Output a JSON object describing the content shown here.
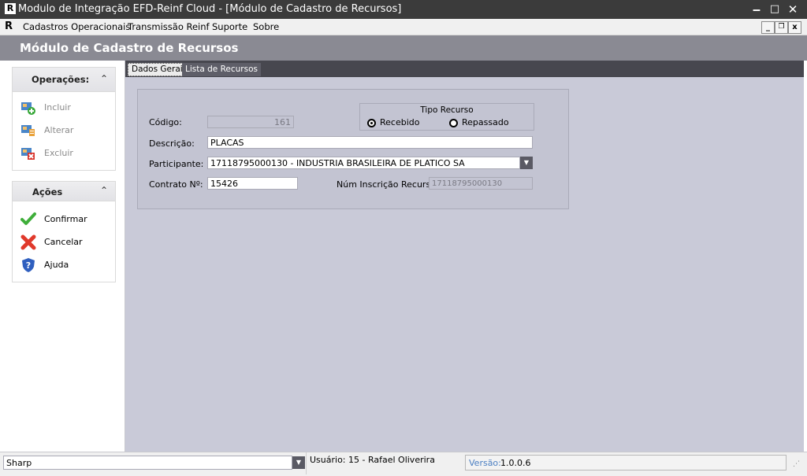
{
  "window": {
    "title": "Modulo de Integração EFD-Reinf Cloud - [Módulo de Cadastro de Recursos]",
    "logo": "R",
    "controls": {
      "minimize": "▁",
      "maximize": "□",
      "close": "✕"
    }
  },
  "menu": {
    "logo": "R",
    "items": [
      "Cadastros Operacionais",
      "Transmissão Reinf",
      "Suporte",
      "Sobre"
    ],
    "mdi": {
      "minimize": "_",
      "restore": "🗗",
      "close": "x"
    }
  },
  "header": {
    "title": "Módulo de Cadastro de Recursos"
  },
  "sidebar": {
    "operacoes": {
      "title": "Operações:",
      "items": [
        {
          "label": "Incluir",
          "icon": "add-record-icon"
        },
        {
          "label": "Alterar",
          "icon": "edit-record-icon"
        },
        {
          "label": "Excluir",
          "icon": "delete-record-icon"
        }
      ]
    },
    "acoes": {
      "title": "Ações",
      "items": [
        {
          "label": "Confirmar",
          "icon": "checkmark-icon"
        },
        {
          "label": "Cancelar",
          "icon": "cross-icon"
        },
        {
          "label": "Ajuda",
          "icon": "help-shield-icon"
        }
      ]
    },
    "chevron": "⌃"
  },
  "tabs": [
    "Dados Gerais",
    "Lista de Recursos"
  ],
  "form": {
    "codigo": {
      "label": "Código:",
      "value": "161"
    },
    "tipo_recurso": {
      "title": "Tipo Recurso",
      "options": [
        "Recebido",
        "Repassado"
      ],
      "selected": "Recebido"
    },
    "descricao": {
      "label": "Descrição:",
      "value": "PLACAS"
    },
    "participante": {
      "label": "Participante:",
      "value": "17118795000130 - INDUSTRIA BRASILEIRA DE PLATICO SA"
    },
    "contrato": {
      "label": "Contrato Nº:",
      "value": "15426"
    },
    "inscricao": {
      "label": "Núm Inscrição Recurso:",
      "value": "17118795000130"
    }
  },
  "statusbar": {
    "theme": "Sharp",
    "user": "Usuário: 15 - Rafael Oliverira",
    "version_label": "Versão:",
    "version_value": "1.0.0.6"
  },
  "colors": {
    "titlebar": "#3b3b3b",
    "header": "#8a8a93",
    "content": "#c9cad8",
    "tabstrip": "#47474f",
    "version_label": "#4a7ec2"
  }
}
